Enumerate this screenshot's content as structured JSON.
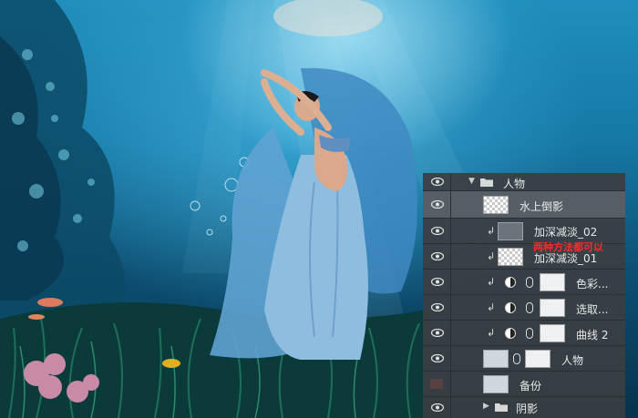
{
  "layers_panel": {
    "group_name": "人物",
    "layers": [
      {
        "name": "水上倒影"
      },
      {
        "name": "加深减淡_02"
      },
      {
        "name": "加深减淡_01"
      },
      {
        "name": "色彩..."
      },
      {
        "name": "选取..."
      },
      {
        "name": "曲线 2"
      },
      {
        "name": "人物"
      },
      {
        "name": "备份"
      },
      {
        "name": "阴影"
      }
    ],
    "annotation": "两种方法都可以"
  },
  "colors": {
    "panel_bg": "#3a3e42",
    "annotation_red": "#ff2a2a",
    "water_blue": "#1677a3"
  },
  "icons": [
    "eye-icon",
    "folder-icon",
    "clip-arrow-icon",
    "adjustment-icon",
    "link-icon",
    "disclosure-triangle-icon"
  ]
}
